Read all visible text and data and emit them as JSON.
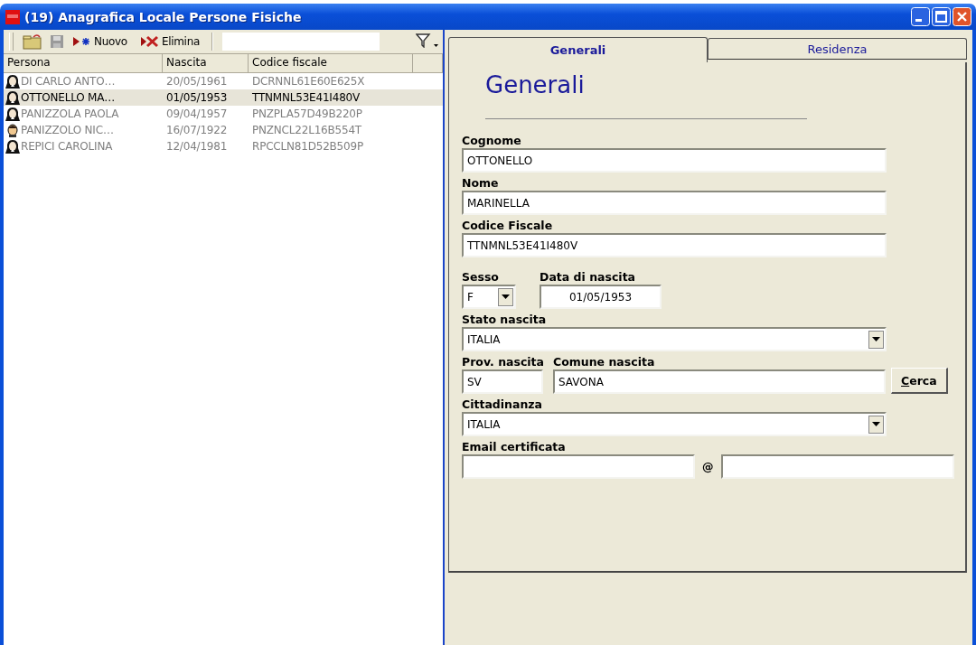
{
  "window": {
    "title": "(19) Anagrafica Locale Persone Fisiche"
  },
  "toolbar": {
    "buttons": [
      {
        "label": "Nuovo",
        "kind": "new"
      },
      {
        "label": "Elimina",
        "kind": "delete"
      }
    ]
  },
  "table": {
    "columns": [
      "Persona",
      "Nascita",
      "Codice fiscale"
    ],
    "rows": [
      {
        "kind": "female",
        "selected": false,
        "cells": [
          "DI CARLO ANTO…",
          "20/05/1961",
          "DCRNNL61E60E625X"
        ]
      },
      {
        "kind": "female",
        "selected": true,
        "cells": [
          "OTTONELLO MA…",
          "01/05/1953",
          "TTNMNL53E41I480V"
        ]
      },
      {
        "kind": "female",
        "selected": false,
        "cells": [
          "PANIZZOLA PAOLA",
          "09/04/1957",
          "PNZPLA57D49B220P"
        ]
      },
      {
        "kind": "male",
        "selected": false,
        "cells": [
          "PANIZZOLO NIC…",
          "16/07/1922",
          "PNZNCL22L16B554T"
        ]
      },
      {
        "kind": "female",
        "selected": false,
        "cells": [
          "REPICI CAROLINA",
          "12/04/1981",
          "RPCCLN81D52B509P"
        ]
      }
    ]
  },
  "tabs": [
    {
      "label": "Generali",
      "selected": true
    },
    {
      "label": "Residenza",
      "selected": false
    }
  ],
  "form": {
    "heading": "Generali",
    "rows": [
      [
        {
          "kind": "text",
          "label": "Cognome",
          "value": "OTTONELLO"
        }
      ],
      [
        {
          "kind": "text",
          "label": "Nome",
          "value": "MARINELLA"
        }
      ],
      [
        {
          "kind": "text",
          "label": "Codice Fiscale",
          "value": "TTNMNL53E41I480V"
        }
      ],
      [
        {
          "kind": "combo",
          "label": "Sesso",
          "value": "F"
        },
        {
          "kind": "date",
          "label": "Data di nascita",
          "value": "01/05/1953"
        }
      ],
      [
        {
          "kind": "combo",
          "label": "Stato nascita",
          "value": "ITALIA"
        }
      ],
      [
        {
          "kind": "text",
          "label": "Prov. nascita",
          "value": "SV"
        },
        {
          "kind": "text",
          "label": "Comune nascita",
          "value": "SAVONA"
        },
        {
          "kind": "button",
          "label": "Cerca"
        }
      ],
      [
        {
          "kind": "combo",
          "label": "Cittadinanza",
          "value": "ITALIA"
        }
      ],
      [
        {
          "kind": "email",
          "label": "Email certificata",
          "separator": "@"
        }
      ]
    ]
  }
}
